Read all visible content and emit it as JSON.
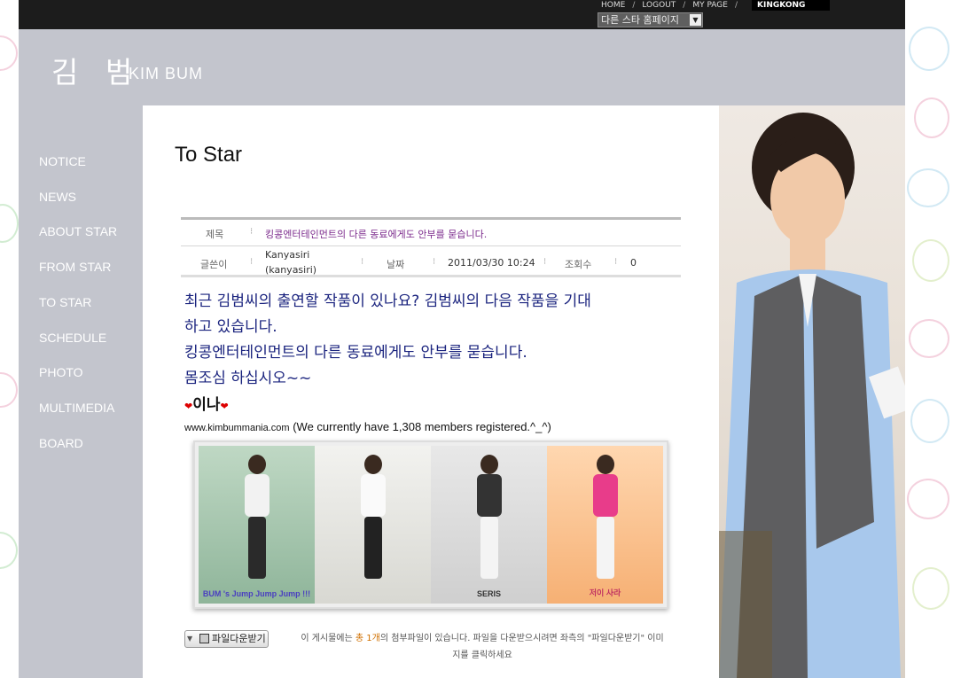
{
  "topnav": {
    "home": "HOME",
    "logout": "LOGOUT",
    "mypage": "MY PAGE",
    "kingkong": "KINGKONG",
    "separator": "/"
  },
  "star_select": {
    "value": "다른 스타 홈페이지"
  },
  "logo": {
    "korean": "김 범",
    "english": "KIM BUM"
  },
  "sidebar": {
    "items": [
      {
        "label": "NOTICE"
      },
      {
        "label": "NEWS"
      },
      {
        "label": "ABOUT STAR"
      },
      {
        "label": "FROM STAR"
      },
      {
        "label": "TO STAR"
      },
      {
        "label": "SCHEDULE"
      },
      {
        "label": "PHOTO"
      },
      {
        "label": "MULTIMEDIA"
      },
      {
        "label": "BOARD"
      }
    ]
  },
  "page": {
    "title": "To Star"
  },
  "post": {
    "subject_label": "제목",
    "subject": "킹콩엔터테인먼트의 다른 동료에게도 안부를 묻습니다.",
    "author_label": "글쓴이",
    "author_name": "Kanyasiri",
    "author_id": "(kanyasiri)",
    "date_label": "날짜",
    "date": "2011/03/30 10:24",
    "views_label": "조회수",
    "views": "0",
    "body": [
      "최근 김범씨의 출연할 작품이 있나요? 김범씨의 다음 작품을 기대",
      "하고 있습니다.",
      "킹콩엔터테인먼트의 다른 동료에게도 안부를 묻습니다.",
      "몸조심 하십시오~~"
    ],
    "signature": "이나",
    "site_url": "www.kimbummania.com",
    "site_note": "(We currently have 1,308 members registered.^_^)",
    "banner_captions": [
      "BUM 's Jump Jump Jump !!!",
      "",
      "SERIS",
      "저이 사라"
    ]
  },
  "download": {
    "button_label": "파일다운받기",
    "note_prefix": "이 게시물에는",
    "note_count": "총 1개",
    "note_middle": "의 첨부파일이 있습니다. 파일을 다운받으시려면 좌측의 \"파일다운받기\" 이미",
    "note_suffix": "지를 클릭하세요"
  },
  "colors": {
    "sidebar_bg": "#c3c5cd",
    "topbar_bg": "#1c1c1c",
    "body_text": "#1a237e",
    "subject_text": "#7b2a8c"
  }
}
